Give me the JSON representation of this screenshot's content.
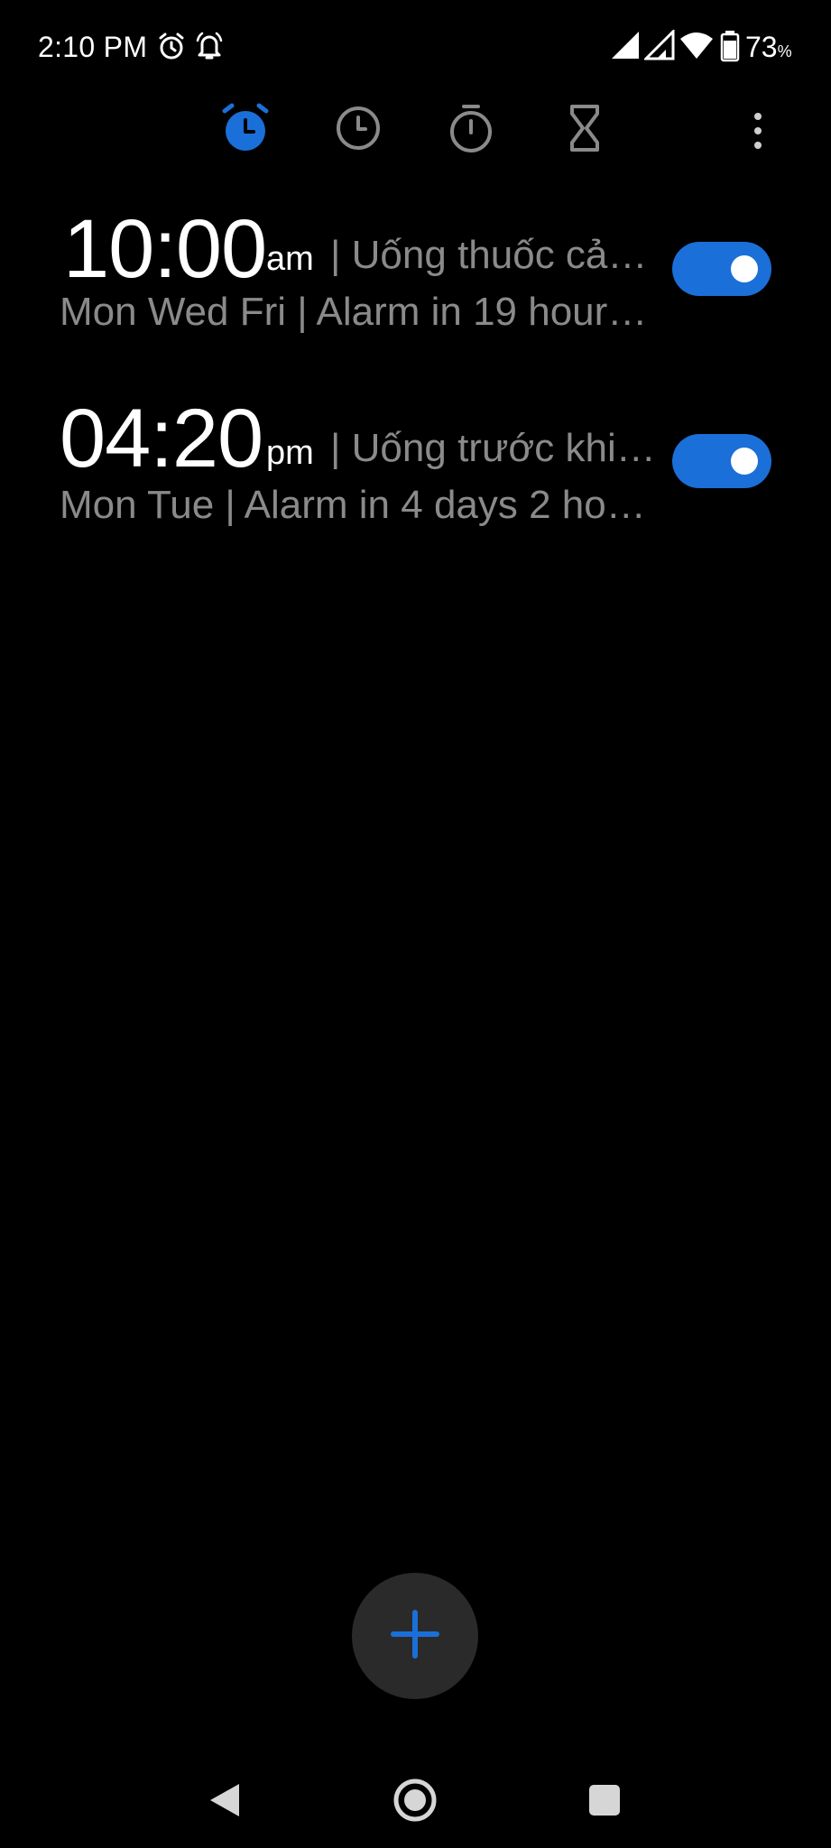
{
  "status_bar": {
    "time": "2:10 PM",
    "battery_percent": "73",
    "battery_unit": "%",
    "icons": [
      "alarm-icon",
      "bell-icon",
      "signal-icon",
      "signal-icon",
      "wifi-icon",
      "battery-icon"
    ]
  },
  "tabs": [
    {
      "name": "alarm",
      "icon": "alarm-clock-icon",
      "active": true
    },
    {
      "name": "clock",
      "icon": "clock-icon",
      "active": false
    },
    {
      "name": "stopwatch",
      "icon": "stopwatch-icon",
      "active": false
    },
    {
      "name": "timer",
      "icon": "hourglass-icon",
      "active": false
    }
  ],
  "menu_icon": "more-vertical-icon",
  "colors": {
    "accent": "#1b6fd8",
    "background": "#000000",
    "secondary_text": "#8a8a8a",
    "fab_background": "#2a2a2a"
  },
  "alarms": [
    {
      "time": "10:00",
      "ampm": "am",
      "label": "| Uống thuốc cả…",
      "subtitle": "Mon Wed Fri | Alarm in 19 hour…",
      "enabled": true
    },
    {
      "time": "04:20",
      "ampm": "pm",
      "label": "| Uống trước khi…",
      "subtitle": "Mon Tue | Alarm in 4 days 2 ho…",
      "enabled": true
    }
  ],
  "fab": {
    "icon": "plus-icon"
  },
  "nav_bar": {
    "icons": [
      "back-icon",
      "home-icon",
      "recents-icon"
    ]
  }
}
